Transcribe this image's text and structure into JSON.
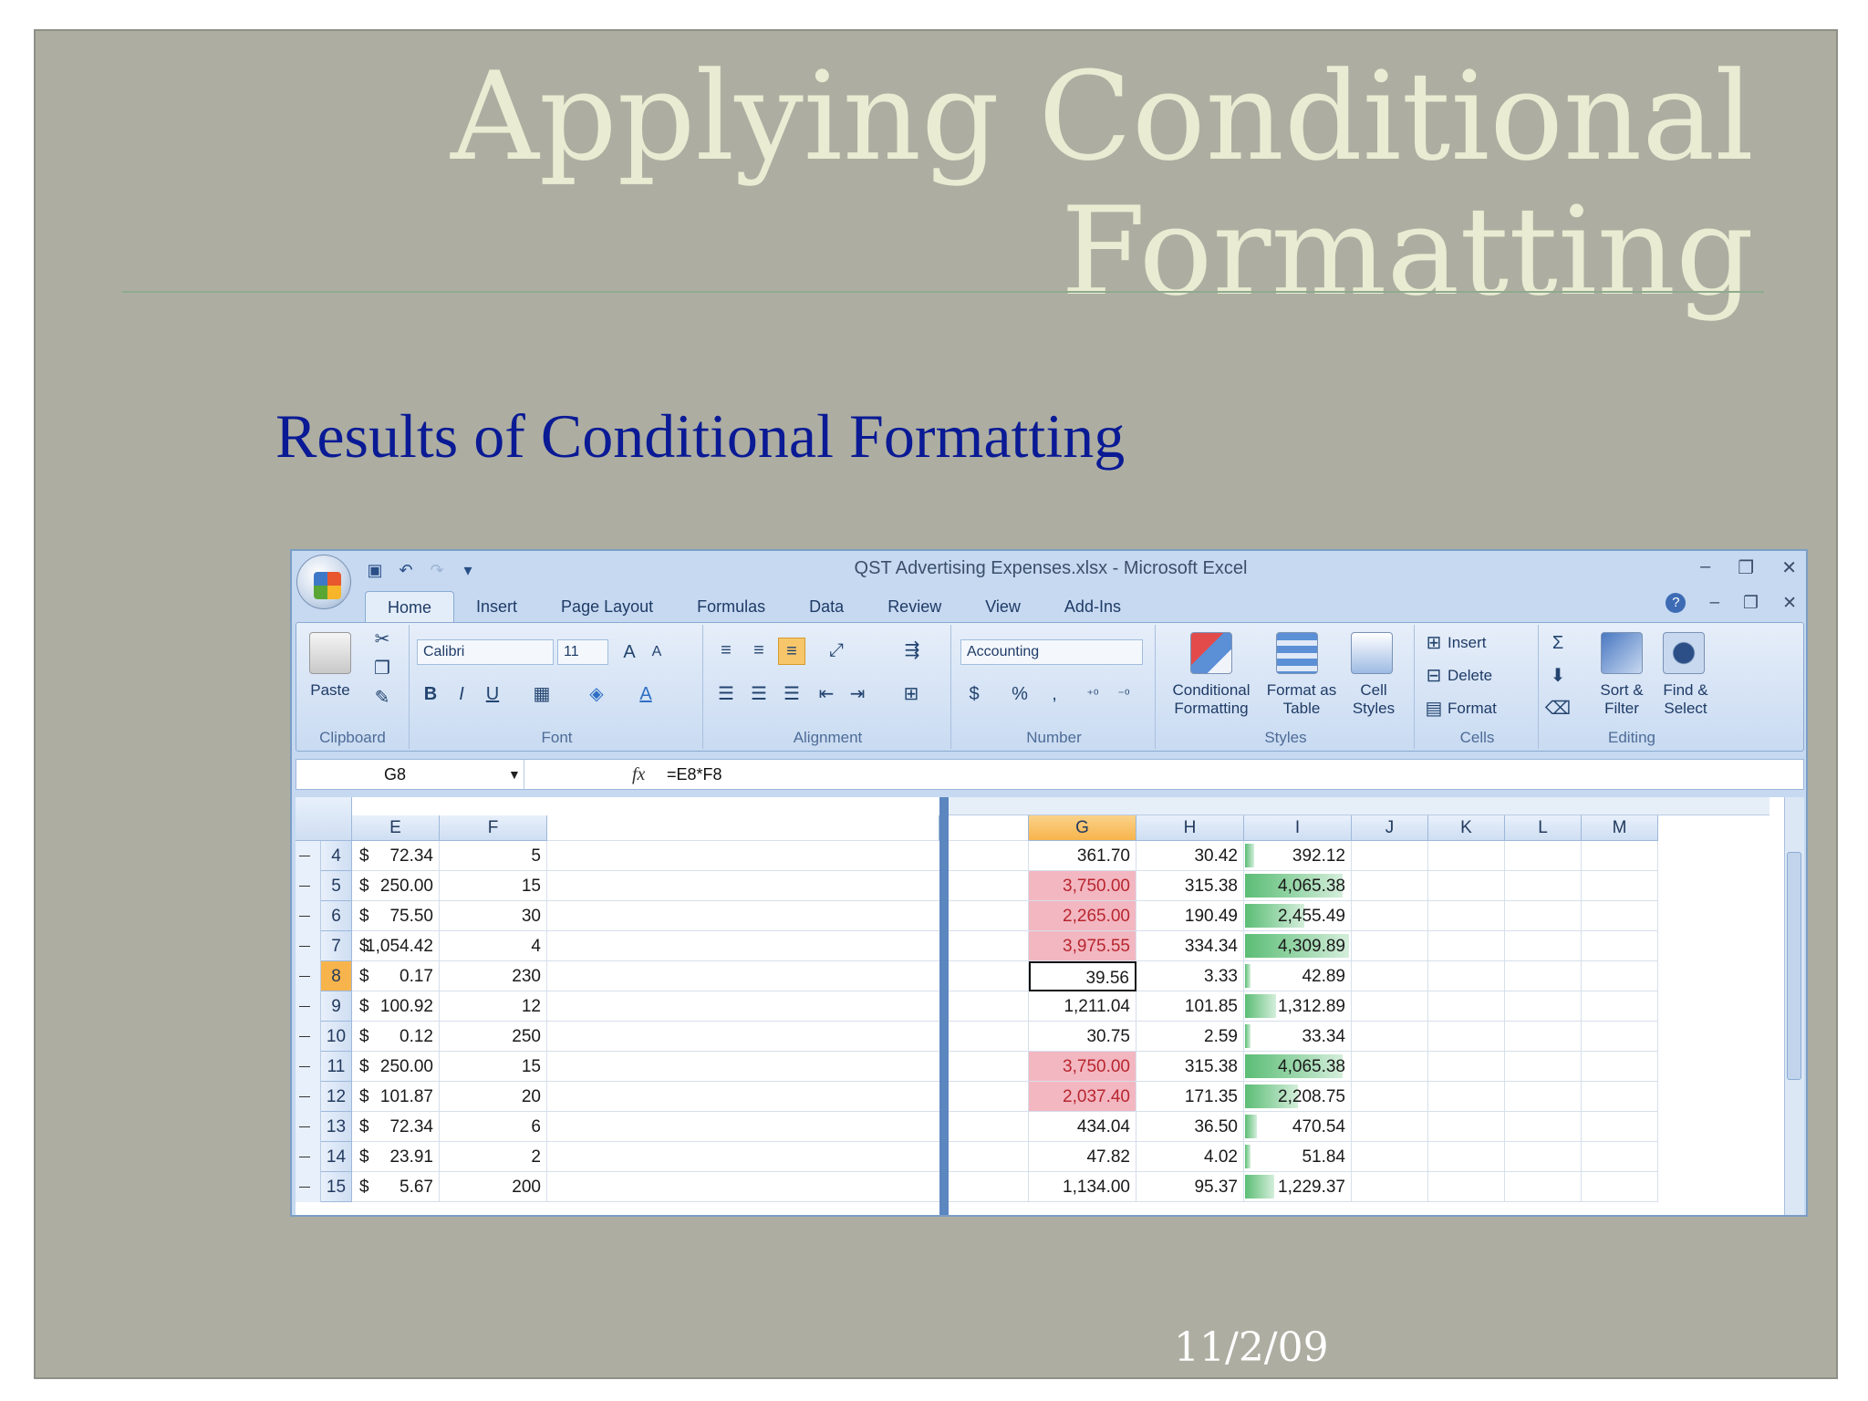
{
  "slide": {
    "title_line1": "Applying Conditional",
    "title_line2": "Formatting",
    "subtitle": "Results of Conditional Formatting",
    "date": "11/2/09"
  },
  "window": {
    "title": "QST Advertising Expenses.xlsx - Microsoft Excel",
    "minimize": "–",
    "restore": "❐",
    "close": "✕",
    "help": "?"
  },
  "tabs": [
    "Home",
    "Insert",
    "Page Layout",
    "Formulas",
    "Data",
    "Review",
    "View",
    "Add-Ins"
  ],
  "ribbon": {
    "clipboard": {
      "label": "Clipboard",
      "paste": "Paste"
    },
    "font": {
      "label": "Font",
      "name": "Calibri",
      "size": "11",
      "bold": "B",
      "italic": "I",
      "underline": "U"
    },
    "alignment": {
      "label": "Alignment"
    },
    "number": {
      "label": "Number",
      "format": "Accounting",
      "currency": "$",
      "percent": "%",
      "comma": ","
    },
    "styles": {
      "label": "Styles",
      "conditional": "Conditional Formatting",
      "format_table": "Format as Table",
      "cell_styles": "Cell Styles"
    },
    "cells": {
      "label": "Cells",
      "insert": "Insert",
      "delete": "Delete",
      "format": "Format"
    },
    "editing": {
      "label": "Editing",
      "sum": "Σ",
      "sort": "Sort & Filter",
      "find": "Find & Select"
    }
  },
  "formula_bar": {
    "name_box": "G8",
    "fx": "fx",
    "formula": "=E8*F8"
  },
  "columns_left": [
    "E",
    "F"
  ],
  "columns_right": [
    "G",
    "H",
    "I",
    "J",
    "K",
    "L",
    "M"
  ],
  "active_cell": {
    "row": "8",
    "col": "G"
  },
  "rows": [
    {
      "num": "4",
      "e": "72.34",
      "f": "5",
      "g": "361.70",
      "h": "30.42",
      "i": "392.12",
      "red": false,
      "bar": 0.09
    },
    {
      "num": "5",
      "e": "250.00",
      "f": "15",
      "g": "3,750.00",
      "h": "315.38",
      "i": "4,065.38",
      "red": true,
      "bar": 0.94
    },
    {
      "num": "6",
      "e": "75.50",
      "f": "30",
      "g": "2,265.00",
      "h": "190.49",
      "i": "2,455.49",
      "red": true,
      "bar": 0.57
    },
    {
      "num": "7",
      "e": "1,054.42",
      "f": "4",
      "g": "3,975.55",
      "h": "334.34",
      "i": "4,309.89",
      "red": true,
      "bar": 1.0
    },
    {
      "num": "8",
      "e": "0.17",
      "f": "230",
      "g": "39.56",
      "h": "3.33",
      "i": "42.89",
      "red": false,
      "bar": 0.02
    },
    {
      "num": "9",
      "e": "100.92",
      "f": "12",
      "g": "1,211.04",
      "h": "101.85",
      "i": "1,312.89",
      "red": false,
      "bar": 0.3
    },
    {
      "num": "10",
      "e": "0.12",
      "f": "250",
      "g": "30.75",
      "h": "2.59",
      "i": "33.34",
      "red": false,
      "bar": 0.01
    },
    {
      "num": "11",
      "e": "250.00",
      "f": "15",
      "g": "3,750.00",
      "h": "315.38",
      "i": "4,065.38",
      "red": true,
      "bar": 0.94
    },
    {
      "num": "12",
      "e": "101.87",
      "f": "20",
      "g": "2,037.40",
      "h": "171.35",
      "i": "2,208.75",
      "red": true,
      "bar": 0.51
    },
    {
      "num": "13",
      "e": "72.34",
      "f": "6",
      "g": "434.04",
      "h": "36.50",
      "i": "470.54",
      "red": false,
      "bar": 0.11
    },
    {
      "num": "14",
      "e": "23.91",
      "f": "2",
      "g": "47.82",
      "h": "4.02",
      "i": "51.84",
      "red": false,
      "bar": 0.02
    },
    {
      "num": "15",
      "e": "5.67",
      "f": "200",
      "g": "1,134.00",
      "h": "95.37",
      "i": "1,229.37",
      "red": false,
      "bar": 0.28
    }
  ],
  "currency_symbol": "$",
  "colors": {
    "slide_bg": "#adaea1",
    "title": "#e9ecd2",
    "subtitle": "#0a1a95",
    "highlight_red": "#f2b7c1",
    "data_bar_green": "#5bbd75"
  }
}
